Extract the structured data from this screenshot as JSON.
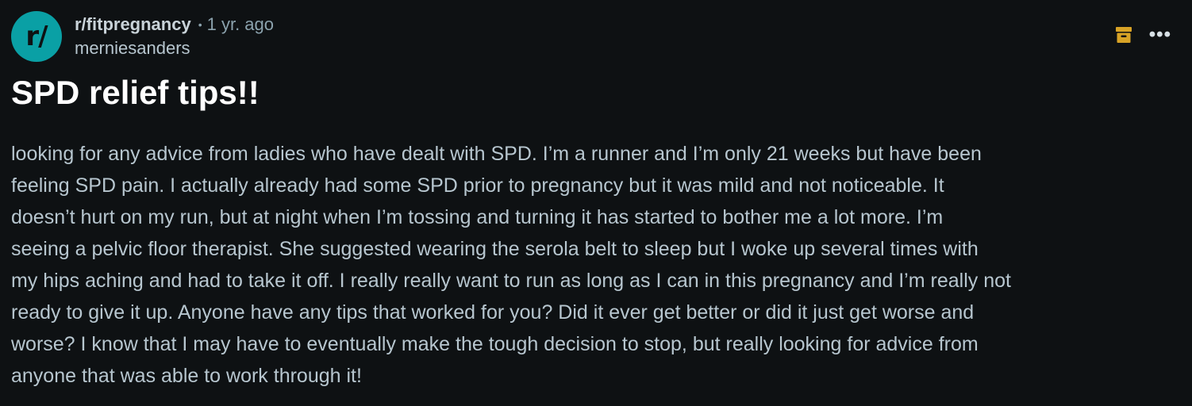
{
  "post": {
    "avatar_text": "r/",
    "subreddit": "r/fitpregnancy",
    "separator": "•",
    "time": "1 yr. ago",
    "author": "merniesanders",
    "title": "SPD relief tips!!",
    "body_lines": [
      "looking for any advice from ladies who have dealt with SPD. I’m a runner and I’m only 21 weeks but have been",
      "feeling SPD pain. I actually already had some SPD prior to pregnancy but it was mild and not noticeable. It",
      "doesn’t hurt on my run, but at night when I’m tossing and turning it has started to bother me a lot more. I’m",
      "seeing a pelvic floor therapist. She suggested wearing the serola belt to sleep but I woke up several times with",
      "my hips aching and had to take it off. I really really want to run as long as I can in this pregnancy and I’m really not",
      "ready to give it up. Anyone have any tips that worked for you? Did it ever get better or did it just get worse and",
      "worse? I know that I may have to eventually make the tough decision to stop, but really looking for advice from",
      "anyone that was able to work through it!"
    ]
  },
  "actions": {
    "archive_icon": "archive-icon",
    "more_icon": "more-options-icon",
    "more_glyph": "•••"
  },
  "colors": {
    "background": "#0e1113",
    "avatar": "#0aa0a5",
    "archive": "#d8a326",
    "title": "#ffffff",
    "body_text": "#b7c6cf",
    "meta_text": "#8ba2ad"
  }
}
